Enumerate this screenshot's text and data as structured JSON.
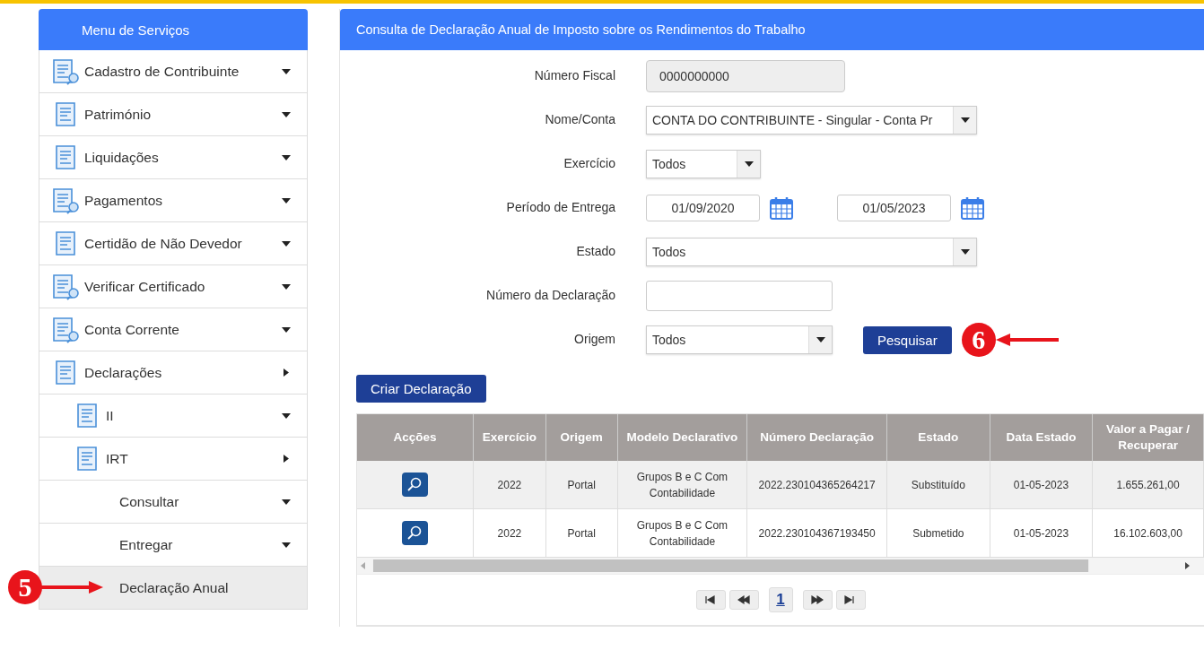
{
  "sidebar": {
    "title": "Menu de Serviços",
    "items": [
      {
        "label": "Cadastro de Contribuinte",
        "expanded": false
      },
      {
        "label": "Património",
        "expanded": false
      },
      {
        "label": "Liquidações",
        "expanded": false
      },
      {
        "label": "Pagamentos",
        "expanded": false
      },
      {
        "label": "Certidão de Não Devedor",
        "expanded": false
      },
      {
        "label": "Verificar Certificado",
        "expanded": false
      },
      {
        "label": "Conta Corrente",
        "expanded": false
      },
      {
        "label": "Declarações",
        "expanded": true,
        "children": [
          {
            "label": "II",
            "expanded": false
          },
          {
            "label": "IRT",
            "expanded": true,
            "children": [
              {
                "label": "Consultar",
                "expanded": false,
                "selected": false
              },
              {
                "label": "Entregar",
                "expanded": false,
                "selected": false
              },
              {
                "label": "Declaração Anual",
                "selected": true,
                "callout": "5"
              }
            ]
          }
        ]
      }
    ]
  },
  "main": {
    "title": "Consulta de Declaração Anual de Imposto sobre os Rendimentos do Trabalho",
    "form": [
      {
        "kind": "readonly",
        "label": "Número Fiscal",
        "value": "0000000000"
      },
      {
        "kind": "select",
        "label": "Nome/Conta",
        "value": "CONTA DO CONTRIBUINTE - Singular - Conta Pr"
      },
      {
        "kind": "select",
        "label": "Exercício",
        "value": "Todos"
      },
      {
        "kind": "dates",
        "label": "Período de Entrega",
        "values": [
          "01/09/2020",
          "01/05/2023"
        ]
      },
      {
        "kind": "select",
        "label": "Estado",
        "value": "Todos"
      },
      {
        "kind": "text",
        "label": "Número da Declaração"
      },
      {
        "kind": "select",
        "label": "Origem",
        "value": "Todos",
        "button": "Pesquisar",
        "callout": "6"
      }
    ],
    "create_button": "Criar Declaração",
    "table": {
      "columns": [
        "Acções",
        "Exercício",
        "Origem",
        "Modelo Declarativo",
        "Número Declaração",
        "Estado",
        "Data Estado",
        "Valor a Pagar / Recuperar"
      ],
      "rows": [
        {
          "cells": [
            "",
            "2022",
            "Portal",
            "Grupos B e C Com Contabilidade",
            "2022.230104365264217",
            "Substituído",
            "01-05-2023",
            "1.655.261,00"
          ]
        },
        {
          "cells": [
            "",
            "2022",
            "Portal",
            "Grupos B e C Com Contabilidade",
            "2022.230104367193450",
            "Submetido",
            "01-05-2023",
            "16.102.603,00"
          ]
        }
      ]
    },
    "pagination": {
      "pages": [
        {
          "label": "1",
          "selected": true
        }
      ]
    }
  }
}
